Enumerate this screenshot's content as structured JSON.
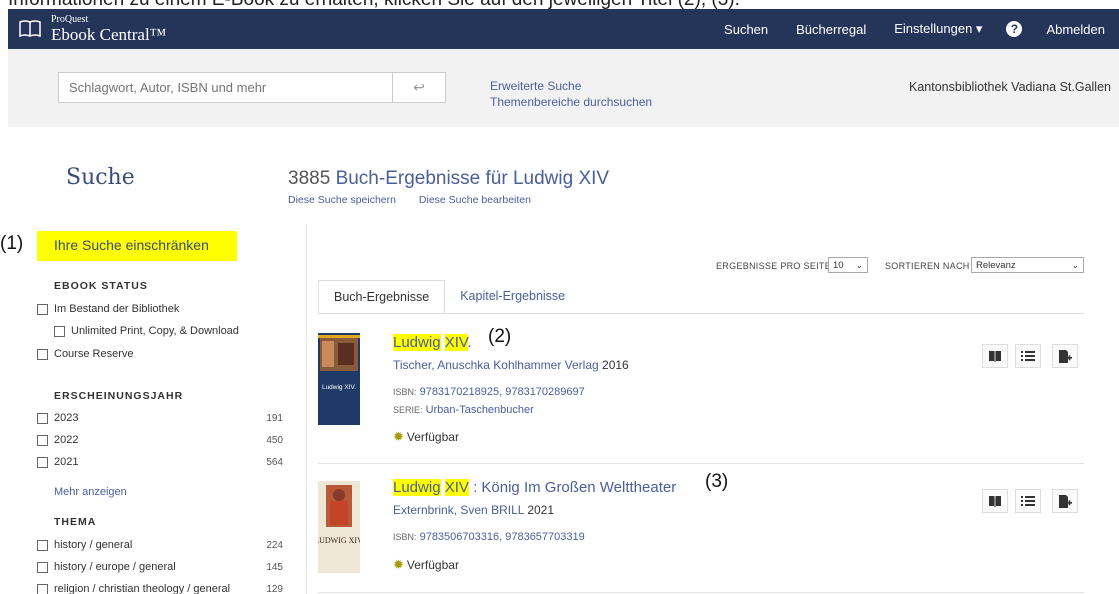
{
  "caption": {
    "top_text": "Informationen zu einem E-Book zu erhalten, klicken Sie auf den jeweiligen Titel (2), (3).",
    "annot_1": "(1)",
    "annot_2": "(2)",
    "annot_3": "(3)"
  },
  "navbar": {
    "logo_small": "ProQuest",
    "logo_main": "Ebook Central™",
    "links": {
      "search": "Suchen",
      "bookshelf": "Bücherregal",
      "settings": "Einstellungen ▾",
      "help": "?",
      "logout": "Abmelden"
    }
  },
  "searchbar": {
    "placeholder": "Schlagwort, Autor, ISBN und mehr",
    "submit_icon": "↩",
    "advanced_search": "Erweiterte Suche",
    "browse_subjects": "Themenbereiche durchsuchen",
    "library_name": "Kantonsbibliothek Vadiana St.Gallen"
  },
  "sidebar": {
    "title": "Suche",
    "refine_label": "Ihre Suche einschränken",
    "ebook_status": {
      "heading": "EBOOK STATUS",
      "items": [
        "Im Bestand der Bibliothek",
        "Unlimited Print, Copy, & Download",
        "Course Reserve"
      ]
    },
    "year": {
      "heading": "ERSCHEINUNGSJAHR",
      "items": [
        {
          "label": "2023",
          "count": "191"
        },
        {
          "label": "2022",
          "count": "450"
        },
        {
          "label": "2021",
          "count": "564"
        }
      ],
      "more": "Mehr anzeigen"
    },
    "topic": {
      "heading": "THEMA",
      "items": [
        {
          "label": "history / general",
          "count": "224"
        },
        {
          "label": "history / europe / general",
          "count": "145"
        },
        {
          "label": "religion / christian theology / general",
          "count": "129"
        }
      ]
    }
  },
  "results": {
    "count": "3885",
    "title_rest": "Buch-Ergebnisse für Ludwig XIV",
    "save_search": "Diese Suche speichern",
    "edit_search": "Diese Suche bearbeiten",
    "per_page_label": "ERGEBNISSE PRO SEITE",
    "per_page_value": "10",
    "sort_label": "SORTIEREN NACH",
    "sort_value": "Relevanz",
    "tabs": [
      "Buch-Ergebnisse",
      "Kapitel-Ergebnisse"
    ],
    "items": [
      {
        "title_w1": "Ludwig",
        "title_w2": "XIV",
        "title_rest": ".",
        "author": "Tischer, Anuschka",
        "publisher": "Kohlhammer Verlag",
        "year": "2016",
        "isbn_label": "ISBN:",
        "isbn": "9783170218925, 9783170289697",
        "series_label": "SERIE:",
        "series": "Urban-Taschenbucher",
        "availability": "Verfügbar",
        "cover_text": "Ludwig XIV."
      },
      {
        "title_w1": "Ludwig",
        "title_w2": "XIV",
        "title_rest": " : König Im Großen Welttheater",
        "author": "Externbrink, Sven",
        "publisher": "BRILL",
        "year": "2021",
        "isbn_label": "ISBN:",
        "isbn": "9783506703316, 9783657703319",
        "availability": "Verfügbar",
        "cover_text": "LUDWIG XIV."
      }
    ]
  },
  "colors": {
    "navbar": "#25355a",
    "link": "#4a5f9a",
    "highlight": "#ffff00"
  }
}
